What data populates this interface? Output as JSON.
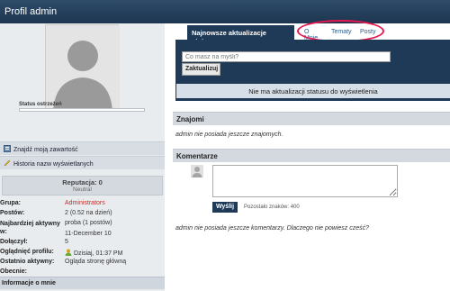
{
  "window": {
    "title": "Profil admin"
  },
  "left": {
    "status_label": "Status ostrzeżeń",
    "links": [
      {
        "label": "Znajdź moją zawartość",
        "icon": "search-content-icon"
      },
      {
        "label": "Historia nazw wyświetlanych",
        "icon": "pencil-icon"
      }
    ],
    "reputation": {
      "title": "Reputacja: 0",
      "level": "Neutral"
    },
    "info": [
      {
        "key": "Grupa:",
        "value": "Administrators"
      },
      {
        "key": "Postów:",
        "value": "2 (0.52 na dzień)"
      },
      {
        "key": "Najbardziej aktywny w:",
        "value": "proba (1 postów)"
      },
      {
        "key": "Dołączył:",
        "value": "11-December 10"
      },
      {
        "key": "Oglądnięć profilu:",
        "value": "5"
      },
      {
        "key": "Ostatnio aktywny:",
        "value": "Dzisiaj, 01:37 PM"
      },
      {
        "key": "Obecnie:",
        "value": "Ogląda stronę główną"
      }
    ],
    "about_header": "Informacje o mnie",
    "group_color": "#d4261f"
  },
  "tabs": {
    "active": "Najnowsze aktualizacje statusu",
    "others": [
      "O Mnie",
      "Tematy",
      "Posty"
    ]
  },
  "status": {
    "placeholder": "Co masz na myśli?",
    "button": "Zaktualizuj",
    "empty": "Nie ma aktualizacji statusu do wyświetlenia"
  },
  "friends": {
    "header": "Znajomi",
    "empty": "admin nie posiada jeszcze znajomych."
  },
  "comments": {
    "header": "Komentarze",
    "send": "Wyślij",
    "remaining": "Pozostało znaków: 400",
    "empty": "admin nie posiada jeszcze komentarzy. Dlaczego nie powiesz cześć?"
  }
}
